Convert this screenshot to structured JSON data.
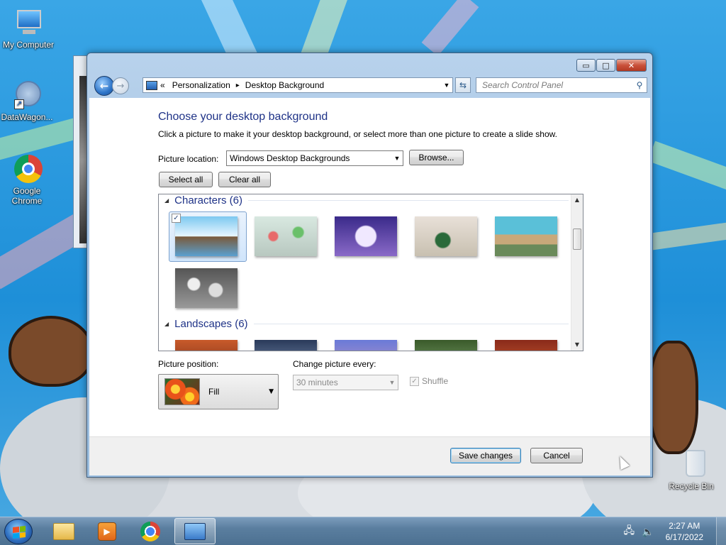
{
  "desktop": {
    "icons": [
      {
        "label": "My Computer"
      },
      {
        "label": "DataWagon..."
      },
      {
        "label": "Google Chrome"
      },
      {
        "label": "Recycle Bin"
      }
    ]
  },
  "window": {
    "caption_buttons": {
      "minimize": "▭",
      "maximize": "□",
      "close": "✕"
    },
    "address": {
      "chevron": "«",
      "crumb1": "Personalization",
      "sep": "▸",
      "crumb2": "Desktop Background"
    },
    "search": {
      "placeholder": "Search Control Panel"
    },
    "heading": "Choose your desktop background",
    "description": "Click a picture to make it your desktop background, or select more than one picture to create a slide show.",
    "picture_location": {
      "label": "Picture location:",
      "value": "Windows Desktop Backgrounds",
      "browse": "Browse..."
    },
    "select_all": "Select all",
    "clear_all": "Clear all",
    "gallery": {
      "groups": [
        {
          "name": "Characters (6)"
        },
        {
          "name": "Landscapes (6)"
        }
      ]
    },
    "picture_position": {
      "label": "Picture position:",
      "value": "Fill"
    },
    "change_every": {
      "label": "Change picture every:",
      "value": "30 minutes"
    },
    "shuffle": {
      "label": "Shuffle",
      "checked": true
    },
    "save": "Save changes",
    "cancel": "Cancel"
  },
  "taskbar": {
    "clock_time": "2:27 AM",
    "clock_date": "6/17/2022"
  }
}
